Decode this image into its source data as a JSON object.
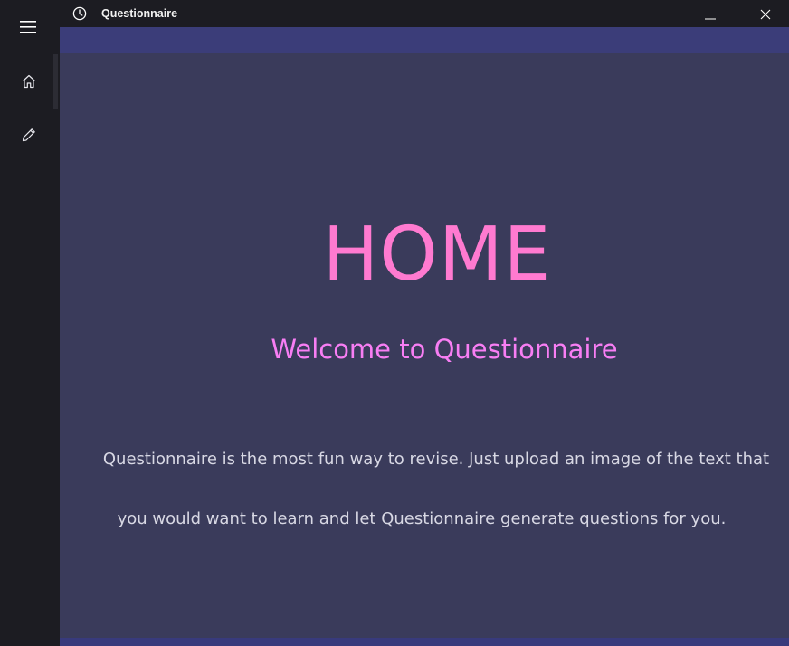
{
  "window": {
    "title": "Questionnaire",
    "app_icon": "clock-icon",
    "controls": [
      "minimize-icon",
      "close-icon"
    ]
  },
  "sidebar": {
    "items": [
      {
        "name": "menu",
        "icon": "hamburger-menu-icon"
      },
      {
        "name": "home",
        "icon": "home-icon",
        "selected": true
      },
      {
        "name": "edit",
        "icon": "pencil-icon"
      }
    ]
  },
  "main": {
    "heading": "HOME",
    "subheading": "Welcome to Questionnaire",
    "description_line1": "Questionnaire is the most fun way to revise. Just upload an image of the text that",
    "description_line2": "you would want to learn and let Questionnaire generate questions for you."
  },
  "colors": {
    "background": "#3a3b5b",
    "accent_band": "#3b3d79",
    "heading": "#ff7ad0",
    "subheading": "#f87ef4",
    "body_text": "#d8d8e4",
    "chrome": "#1c1c22"
  }
}
